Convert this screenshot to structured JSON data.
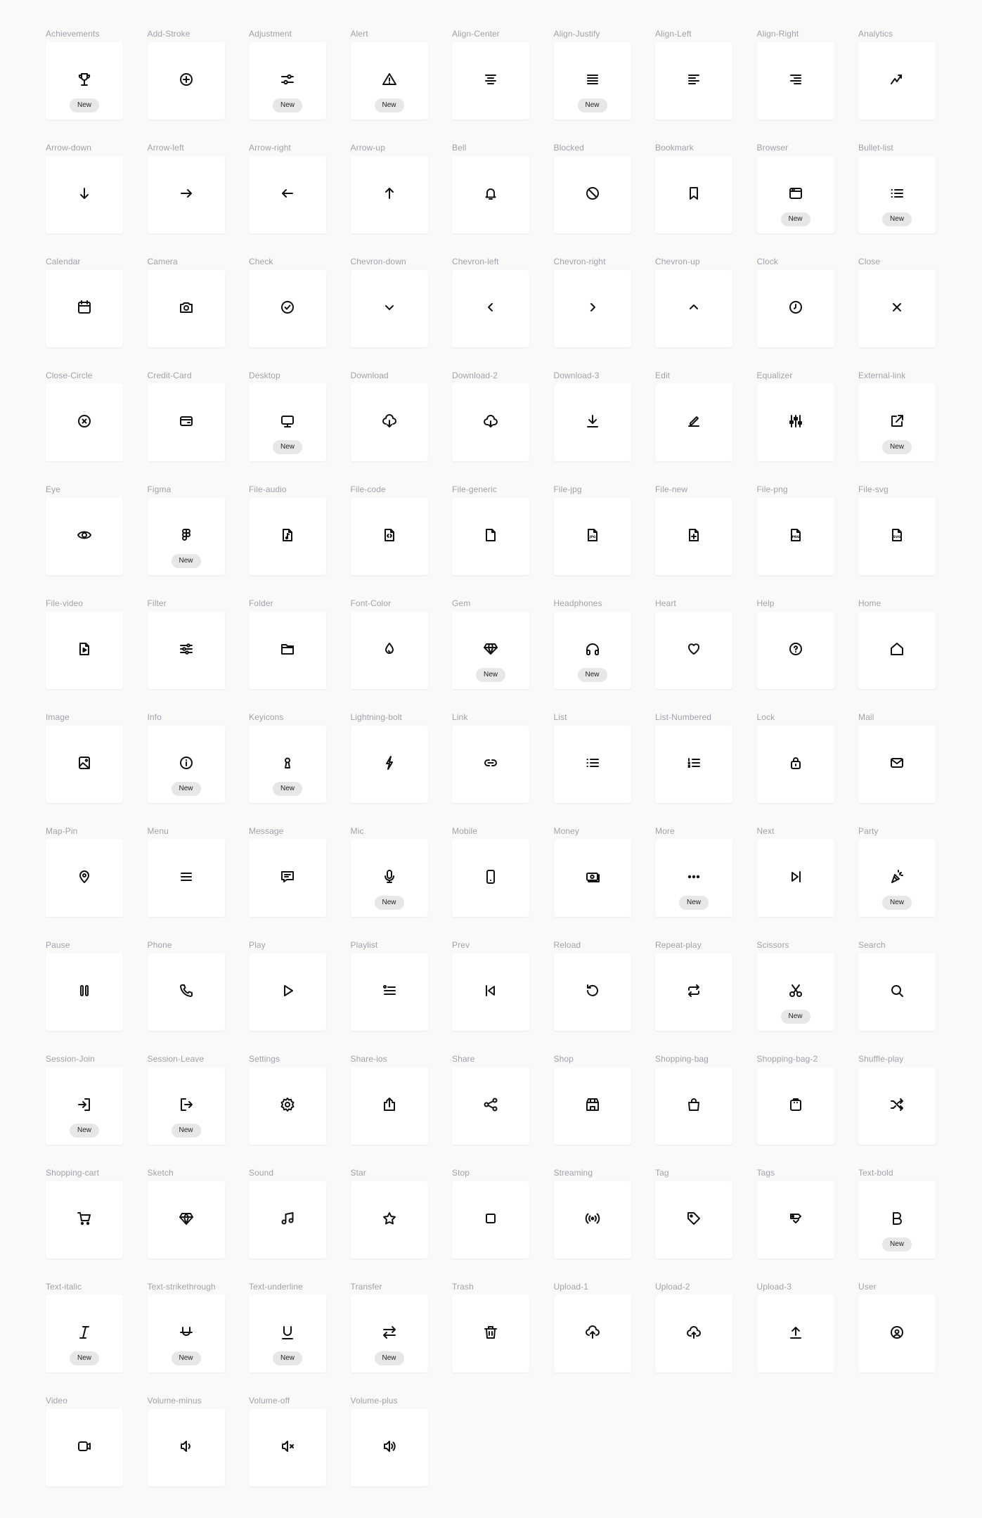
{
  "badge_label": "New",
  "colors": {
    "background": "#faf9f8",
    "card": "#ffffff",
    "label": "#9ea2ab",
    "badge_bg": "#e7e7e8",
    "icon": "#111111"
  },
  "icons": [
    {
      "label": "Achievements",
      "icon": "trophy-icon",
      "new": true
    },
    {
      "label": "Add-Stroke",
      "icon": "plus-circle-icon",
      "new": false
    },
    {
      "label": "Adjustment",
      "icon": "sliders-icon",
      "new": true
    },
    {
      "label": "Alert",
      "icon": "alert-triangle-icon",
      "new": true
    },
    {
      "label": "Align-Center",
      "icon": "align-center-icon",
      "new": false
    },
    {
      "label": "Align-Justify",
      "icon": "align-justify-icon",
      "new": true
    },
    {
      "label": "Align-Left",
      "icon": "align-left-icon",
      "new": false
    },
    {
      "label": "Align-Right",
      "icon": "align-right-icon",
      "new": false
    },
    {
      "label": "Analytics",
      "icon": "trending-up-icon",
      "new": false
    },
    {
      "label": "Arrow-down",
      "icon": "arrow-down-icon",
      "new": false
    },
    {
      "label": "Arrow-left",
      "icon": "arrow-right-glyph-icon",
      "new": false
    },
    {
      "label": "Arrow-right",
      "icon": "arrow-left-glyph-icon",
      "new": false
    },
    {
      "label": "Arrow-up",
      "icon": "arrow-up-icon",
      "new": false
    },
    {
      "label": "Bell",
      "icon": "bell-icon",
      "new": false
    },
    {
      "label": "Blocked",
      "icon": "blocked-icon",
      "new": false
    },
    {
      "label": "Bookmark",
      "icon": "bookmark-icon",
      "new": false
    },
    {
      "label": "Browser",
      "icon": "browser-icon",
      "new": true
    },
    {
      "label": "Bullet-list",
      "icon": "bullet-list-icon",
      "new": true
    },
    {
      "label": "Calendar",
      "icon": "calendar-icon",
      "new": false
    },
    {
      "label": "Camera",
      "icon": "camera-icon",
      "new": false
    },
    {
      "label": "Check",
      "icon": "check-circle-icon",
      "new": false
    },
    {
      "label": "Chevron-down",
      "icon": "chevron-down-icon",
      "new": false
    },
    {
      "label": "Chevron-left",
      "icon": "chevron-left-icon",
      "new": false
    },
    {
      "label": "Chevron-right",
      "icon": "chevron-right-icon",
      "new": false
    },
    {
      "label": "Chevron-up",
      "icon": "chevron-up-icon",
      "new": false
    },
    {
      "label": "Clock",
      "icon": "clock-icon",
      "new": false
    },
    {
      "label": "Close",
      "icon": "close-icon",
      "new": false
    },
    {
      "label": "Close-Circle",
      "icon": "close-circle-icon",
      "new": false
    },
    {
      "label": "Credit-Card",
      "icon": "credit-card-icon",
      "new": false
    },
    {
      "label": "Desktop",
      "icon": "desktop-icon",
      "new": true
    },
    {
      "label": "Download",
      "icon": "cloud-download-icon",
      "new": false
    },
    {
      "label": "Download-2",
      "icon": "cloud-download-2-icon",
      "new": false
    },
    {
      "label": "Download-3",
      "icon": "download-tray-icon",
      "new": false
    },
    {
      "label": "Edit",
      "icon": "pencil-icon",
      "new": false
    },
    {
      "label": "Equalizer",
      "icon": "equalizer-icon",
      "new": false
    },
    {
      "label": "External-link",
      "icon": "external-link-icon",
      "new": true
    },
    {
      "label": "Eye",
      "icon": "eye-icon",
      "new": false
    },
    {
      "label": "Figma",
      "icon": "figma-icon",
      "new": true
    },
    {
      "label": "File-audio",
      "icon": "file-audio-icon",
      "new": false
    },
    {
      "label": "File-code",
      "icon": "file-code-icon",
      "new": false
    },
    {
      "label": "File-generic",
      "icon": "file-icon",
      "new": false
    },
    {
      "label": "File-jpg",
      "icon": "file-jpg-icon",
      "new": false
    },
    {
      "label": "File-new",
      "icon": "file-plus-icon",
      "new": false
    },
    {
      "label": "File-png",
      "icon": "file-png-icon",
      "new": false
    },
    {
      "label": "File-svg",
      "icon": "file-svg-icon",
      "new": false
    },
    {
      "label": "File-video",
      "icon": "file-video-icon",
      "new": false
    },
    {
      "label": "Filter",
      "icon": "filter-sliders-icon",
      "new": false
    },
    {
      "label": "Folder",
      "icon": "folder-icon",
      "new": false
    },
    {
      "label": "Font-Color",
      "icon": "droplet-icon",
      "new": false
    },
    {
      "label": "Gem",
      "icon": "gem-icon",
      "new": true
    },
    {
      "label": "Headphones",
      "icon": "headphones-icon",
      "new": true
    },
    {
      "label": "Heart",
      "icon": "heart-icon",
      "new": false
    },
    {
      "label": "Help",
      "icon": "help-circle-icon",
      "new": false
    },
    {
      "label": "Home",
      "icon": "home-icon",
      "new": false
    },
    {
      "label": "Image",
      "icon": "image-icon",
      "new": false
    },
    {
      "label": "Info",
      "icon": "info-icon",
      "new": true
    },
    {
      "label": "Keyicons",
      "icon": "keyhole-icon",
      "new": true
    },
    {
      "label": "Lightning-bolt",
      "icon": "lightning-icon",
      "new": false
    },
    {
      "label": "Link",
      "icon": "link-icon",
      "new": false
    },
    {
      "label": "List",
      "icon": "list-icon",
      "new": false
    },
    {
      "label": "List-Numbered",
      "icon": "list-numbered-icon",
      "new": false
    },
    {
      "label": "Lock",
      "icon": "lock-icon",
      "new": false
    },
    {
      "label": "Mail",
      "icon": "mail-icon",
      "new": false
    },
    {
      "label": "Map-Pin",
      "icon": "map-pin-icon",
      "new": false
    },
    {
      "label": "Menu",
      "icon": "menu-icon",
      "new": false
    },
    {
      "label": "Message",
      "icon": "message-icon",
      "new": false
    },
    {
      "label": "Mic",
      "icon": "mic-icon",
      "new": true
    },
    {
      "label": "Mobile",
      "icon": "mobile-icon",
      "new": false
    },
    {
      "label": "Money",
      "icon": "money-icon",
      "new": false
    },
    {
      "label": "More",
      "icon": "more-horizontal-icon",
      "new": true
    },
    {
      "label": "Next",
      "icon": "skip-next-icon",
      "new": false
    },
    {
      "label": "Party",
      "icon": "party-popper-icon",
      "new": true
    },
    {
      "label": "Pause",
      "icon": "pause-icon",
      "new": false
    },
    {
      "label": "Phone",
      "icon": "phone-icon",
      "new": false
    },
    {
      "label": "Play",
      "icon": "play-icon",
      "new": false
    },
    {
      "label": "Playlist",
      "icon": "playlist-icon",
      "new": false
    },
    {
      "label": "Prev",
      "icon": "skip-prev-icon",
      "new": false
    },
    {
      "label": "Reload",
      "icon": "reload-icon",
      "new": false
    },
    {
      "label": "Repeat-play",
      "icon": "repeat-icon",
      "new": false
    },
    {
      "label": "Scissors",
      "icon": "scissors-icon",
      "new": true
    },
    {
      "label": "Search",
      "icon": "search-icon",
      "new": false
    },
    {
      "label": "Session-Join",
      "icon": "login-icon",
      "new": true
    },
    {
      "label": "Session-Leave",
      "icon": "logout-icon",
      "new": true
    },
    {
      "label": "Settings",
      "icon": "gear-icon",
      "new": false
    },
    {
      "label": "Share-ios",
      "icon": "share-ios-icon",
      "new": false
    },
    {
      "label": "Share",
      "icon": "share-nodes-icon",
      "new": false
    },
    {
      "label": "Shop",
      "icon": "shop-icon",
      "new": false
    },
    {
      "label": "Shopping-bag",
      "icon": "shopping-bag-icon",
      "new": false
    },
    {
      "label": "Shopping-bag-2",
      "icon": "shopping-bag-2-icon",
      "new": false
    },
    {
      "label": "Shuffle-play",
      "icon": "shuffle-icon",
      "new": false
    },
    {
      "label": "Shopping-cart",
      "icon": "shopping-cart-icon",
      "new": false
    },
    {
      "label": "Sketch",
      "icon": "diamond-icon",
      "new": false
    },
    {
      "label": "Sound",
      "icon": "music-note-icon",
      "new": false
    },
    {
      "label": "Star",
      "icon": "star-icon",
      "new": false
    },
    {
      "label": "Stop",
      "icon": "stop-icon",
      "new": false
    },
    {
      "label": "Streaming",
      "icon": "broadcast-icon",
      "new": false
    },
    {
      "label": "Tag",
      "icon": "tag-icon",
      "new": false
    },
    {
      "label": "Tags",
      "icon": "tags-icon",
      "new": false
    },
    {
      "label": "Text-bold",
      "icon": "text-bold-icon",
      "new": true
    },
    {
      "label": "Text-italic",
      "icon": "text-italic-icon",
      "new": true
    },
    {
      "label": "Text-strikethrough",
      "icon": "text-strikethrough-icon",
      "new": true
    },
    {
      "label": "Text-underline",
      "icon": "text-underline-icon",
      "new": true
    },
    {
      "label": "Transfer",
      "icon": "transfer-icon",
      "new": true
    },
    {
      "label": "Trash",
      "icon": "trash-icon",
      "new": false
    },
    {
      "label": "Upload-1",
      "icon": "cloud-upload-icon",
      "new": false
    },
    {
      "label": "Upload-2",
      "icon": "cloud-upload-2-icon",
      "new": false
    },
    {
      "label": "Upload-3",
      "icon": "upload-icon",
      "new": false
    },
    {
      "label": "User",
      "icon": "user-circle-icon",
      "new": false
    },
    {
      "label": "Video",
      "icon": "video-icon",
      "new": false
    },
    {
      "label": "Volume-minus",
      "icon": "volume-low-icon",
      "new": false
    },
    {
      "label": "Volume-off",
      "icon": "volume-off-icon",
      "new": false
    },
    {
      "label": "Volume-plus",
      "icon": "volume-high-icon",
      "new": false
    }
  ]
}
